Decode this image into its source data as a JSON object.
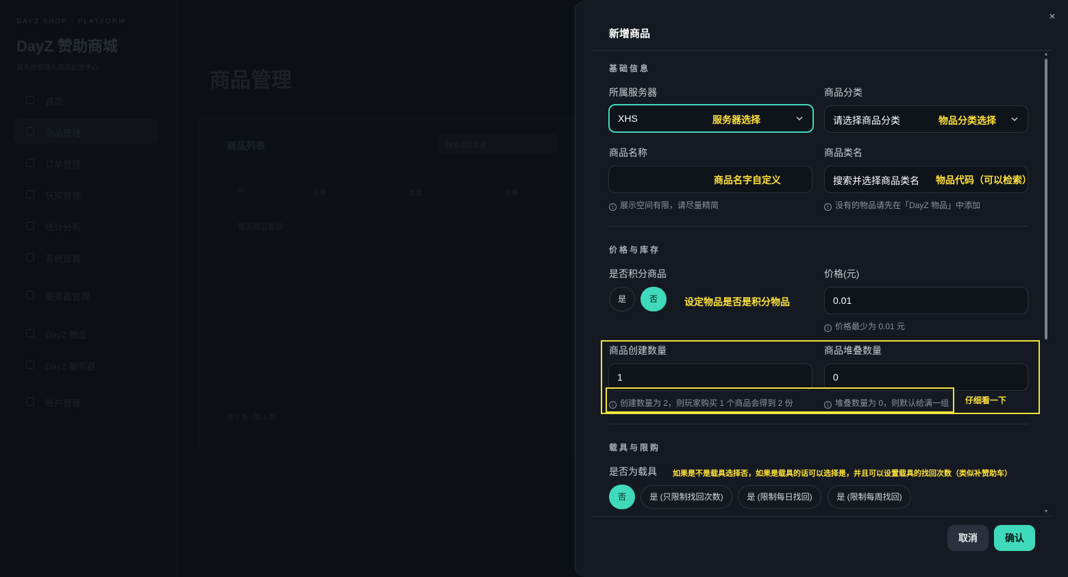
{
  "background": {
    "brand_small": "DAYZ SHOP · PLATFORM",
    "brand": "DayZ 赞助商城",
    "brand_sub": "服务器管理与商品配置中心",
    "nav": [
      "首页",
      "商品管理",
      "订单管理",
      "玩家管理",
      "统计分析",
      "系统设置",
      "服务器管理",
      "DayZ 物品",
      "DayZ 服务器",
      "账户管理"
    ],
    "page_title": "商品管理",
    "card_title": "商品列表",
    "search_placeholder": "搜索商品名称",
    "table_headers": [
      "ID",
      "名称",
      "类型",
      "价格"
    ],
    "empty_text": "暂无商品数据",
    "footer_text": "共 0 条 · 第 1 页"
  },
  "drawer": {
    "title": "新增商品",
    "close_icon": "×",
    "sections": {
      "basic": "基础信息",
      "price_stock": "价格与库存",
      "vehicle_limit": "载具与限购"
    },
    "server": {
      "label": "所属服务器",
      "value": "XHS"
    },
    "category": {
      "label": "商品分类",
      "placeholder": "请选择商品分类"
    },
    "name": {
      "label": "商品名称",
      "value": "",
      "hint": "展示空间有限，请尽量精简"
    },
    "classname": {
      "label": "商品类名",
      "placeholder": "搜索并选择商品类名",
      "hint": "没有的物品请先在「DayZ 物品」中添加"
    },
    "points": {
      "label": "是否积分商品",
      "yes": "是",
      "no": "否",
      "selected": "否"
    },
    "price": {
      "label": "价格(元)",
      "value": "0.01",
      "hint": "价格最少为 0.01 元"
    },
    "create_qty": {
      "label": "商品创建数量",
      "value": "1",
      "hint": "创建数量为 2，则玩家购买 1 个商品会得到 2 份"
    },
    "stack_qty": {
      "label": "商品堆叠数量",
      "value": "0",
      "hint": "堆叠数量为 0，则默认给满一组"
    },
    "vehicle": {
      "label": "是否为载具",
      "options": [
        "否",
        "是 (只限制找回次数)",
        "是 (限制每日找回)",
        "是 (限制每周找回)"
      ],
      "selected": "否"
    },
    "cancel": "取消",
    "confirm": "确认"
  },
  "annotations": {
    "server": "服务器选择",
    "category": "物品分类选择",
    "name": "商品名字自定义",
    "classname": "物品代码（可以检索）",
    "points": "设定物品是否是积分物品",
    "quantity": "仔细看一下",
    "vehicle": "如果是不是载具选择否，如果是载具的话可以选择是，并且可以设置载具的找回次数（类似补赞助车）"
  },
  "colors": {
    "accent": "#3fd9bb",
    "annotation": "#ffe13b",
    "drawer_bg": "#151a22"
  }
}
